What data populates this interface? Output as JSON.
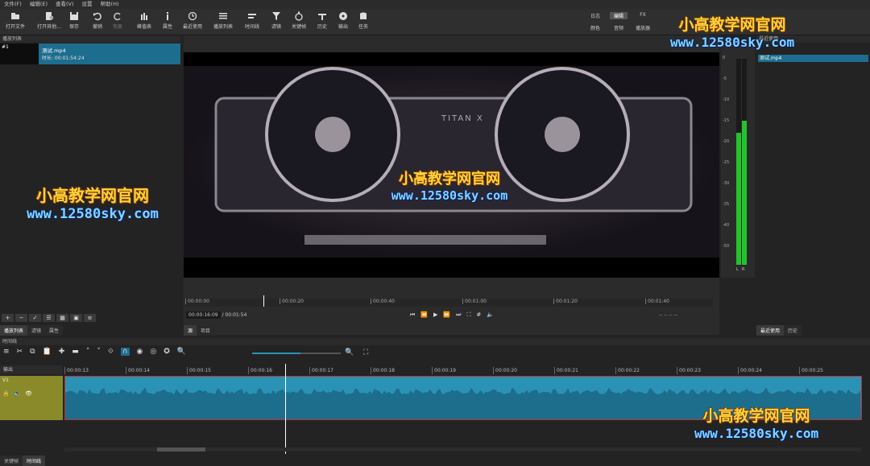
{
  "menu": [
    "文件(F)",
    "编辑(E)",
    "查看(V)",
    "设置",
    "帮助(H)"
  ],
  "toolbar": [
    {
      "label": "打开文件",
      "icon": "open-file-icon"
    },
    {
      "label": "打开其他...",
      "icon": "open-other-icon"
    },
    {
      "label": "保存",
      "icon": "save-icon"
    },
    {
      "label": "撤销",
      "icon": "undo-icon"
    },
    {
      "label": "恢复",
      "icon": "redo-icon"
    },
    {
      "label": "峰值表",
      "icon": "peak-meter-icon"
    },
    {
      "label": "属性",
      "icon": "properties-icon"
    },
    {
      "label": "最近使用",
      "icon": "recent-icon"
    },
    {
      "label": "播放列表",
      "icon": "playlist-icon"
    },
    {
      "label": "时间线",
      "icon": "timeline-icon"
    },
    {
      "label": "滤镜",
      "icon": "filter-icon"
    },
    {
      "label": "关键帧",
      "icon": "keyframe-icon"
    },
    {
      "label": "历史",
      "icon": "history-icon"
    },
    {
      "label": "输出",
      "icon": "export-icon"
    },
    {
      "label": "任务",
      "icon": "jobs-icon"
    }
  ],
  "layouts_top": [
    "日志",
    "编辑",
    "FX"
  ],
  "layouts_bottom": [
    "颜色",
    "音频",
    "播放器"
  ],
  "playlist": {
    "title": "播放列表",
    "item_index": "#1",
    "item_name": "测试.mp4",
    "item_duration": "时长: 00:01:54:24",
    "tabs": [
      "播放列表",
      "滤镜",
      "属性"
    ]
  },
  "player": {
    "ruler": [
      "00:00:00",
      "00:00:20",
      "00:00:40",
      "00:01:00",
      "00:01:20",
      "00:01:40"
    ],
    "current_time": "00:00:16:09",
    "total_time": "/ 00:01:54",
    "tabs": [
      "源",
      "项目"
    ],
    "timecode_right": "-- -- -- --"
  },
  "meter": {
    "scale": [
      "0",
      "-5",
      "-10",
      "-15",
      "-20",
      "-25",
      "-30",
      "-35",
      "-40",
      "-50"
    ],
    "left_label": "L",
    "right_label": "R",
    "left_level_fraction": 0.64,
    "right_level_fraction": 0.7
  },
  "recent": {
    "header": "最近使用",
    "item": "测试.mp4",
    "tabs": [
      "最近使用",
      "历史"
    ]
  },
  "timeline": {
    "title": "时间线",
    "output_label": "输出",
    "track_name": "V1",
    "ticks": [
      "00:00:13",
      "00:00:14",
      "00:00:15",
      "00:00:16",
      "00:00:17",
      "00:00:18",
      "00:00:19",
      "00:00:20",
      "00:00:21",
      "00:00:22",
      "00:00:23",
      "00:00:24",
      "00:00:25"
    ],
    "bottom_tabs": [
      "关键帧",
      "时间线"
    ]
  },
  "watermark": {
    "cn": "小高教学网官网",
    "url": "www.12580sky.com"
  },
  "video_text": "TITAN X",
  "colors": {
    "accent": "#1d6d8f",
    "clip": "#2a93b5",
    "track_header": "#8a8a2a",
    "meter": "#21c42b"
  }
}
